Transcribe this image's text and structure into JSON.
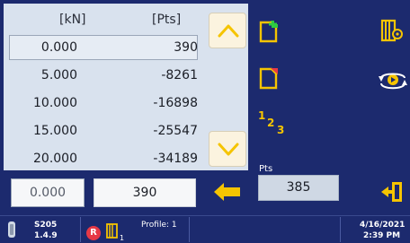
{
  "table": {
    "col1_header": "[kN]",
    "col2_header": "[Pts]",
    "rows": [
      {
        "kn": "0.000",
        "pts": "390"
      },
      {
        "kn": "5.000",
        "pts": "-8261"
      },
      {
        "kn": "10.000",
        "pts": "-16898"
      },
      {
        "kn": "15.000",
        "pts": "-25547"
      },
      {
        "kn": "20.000",
        "pts": "-34189"
      }
    ],
    "selected_row": 0
  },
  "edit": {
    "kn_value": "0.000",
    "pts_value": "390"
  },
  "live": {
    "label": "Pts",
    "value": "385"
  },
  "icons": {
    "new_doc": "document-add-icon",
    "del_doc": "document-remove-icon",
    "numbering": "numbering-icon",
    "numbering_text": {
      "one": "1",
      "two": "2",
      "three": "3"
    },
    "library": "book-settings-icon",
    "rotate": "rotate-view-icon",
    "exit": "exit-icon",
    "apply": "left-arrow-icon"
  },
  "status": {
    "device": "S205",
    "version": "1.4.9",
    "badge": "R",
    "profile": "Profile: 1",
    "profile_sub": "1",
    "date": "4/16/2021",
    "time": "2:39 PM"
  },
  "colors": {
    "background": "#1c2a6e",
    "panel": "#d9e2ee",
    "accent_yellow": "#f5c400",
    "badge_red": "#e63946"
  }
}
